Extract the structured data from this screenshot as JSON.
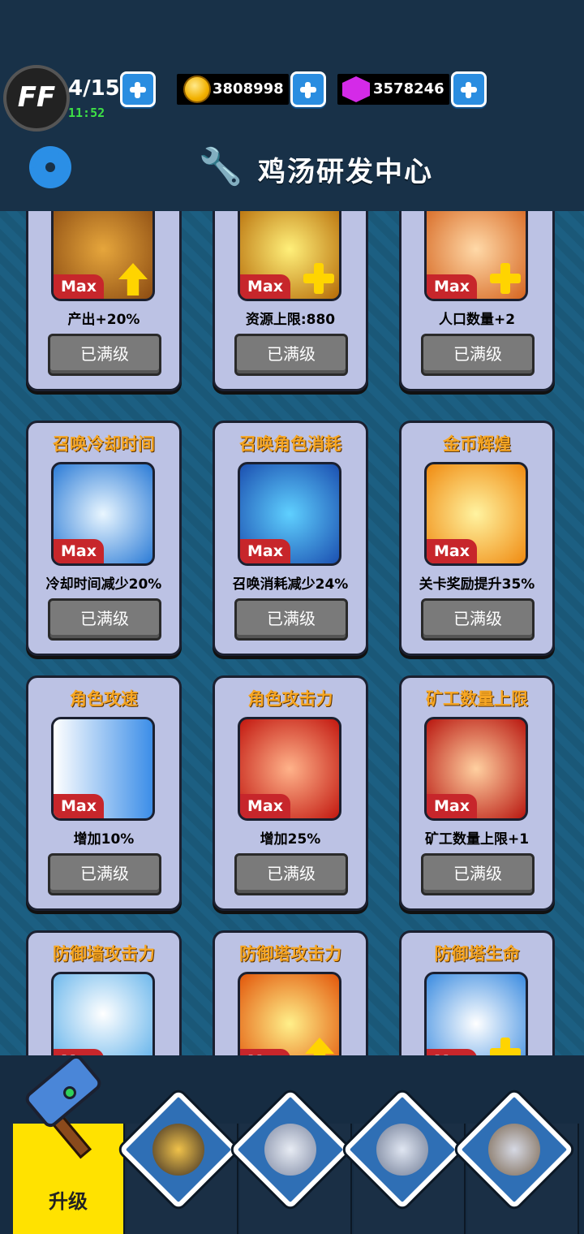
{
  "header": {
    "badge": "FF",
    "energy": "4/15",
    "timer": "11:52",
    "gold": "3808998",
    "gems": "3578246",
    "title": "鸡汤研发中心"
  },
  "cards": [
    {
      "title": "",
      "max": "Max",
      "desc": "产出+20%",
      "button": "已满级",
      "icon": "pickaxe-icon"
    },
    {
      "title": "",
      "max": "Max",
      "desc": "资源上限:880",
      "button": "已满级",
      "icon": "crystal-icon"
    },
    {
      "title": "",
      "max": "Max",
      "desc": "人口数量+2",
      "button": "已满级",
      "icon": "meat-icon"
    },
    {
      "title": "召唤冷却时间",
      "max": "Max",
      "desc": "冷却时间减少20%",
      "button": "已满级",
      "icon": "hourglass-icon"
    },
    {
      "title": "召唤角色消耗",
      "max": "Max",
      "desc": "召唤消耗减少24%",
      "button": "已满级",
      "icon": "discount-card-icon"
    },
    {
      "title": "金币辉煌",
      "max": "Max",
      "desc": "关卡奖励提升35%",
      "button": "已满级",
      "icon": "coins-icon"
    },
    {
      "title": "角色攻速",
      "max": "Max",
      "desc": "增加10%",
      "button": "已满级",
      "icon": "fists-icon"
    },
    {
      "title": "角色攻击力",
      "max": "Max",
      "desc": "增加25%",
      "button": "已满级",
      "icon": "fist-icon"
    },
    {
      "title": "矿工数量上限",
      "max": "Max",
      "desc": "矿工数量上限+1",
      "button": "已满级",
      "icon": "miners-icon"
    },
    {
      "title": "防御墙攻击力",
      "max": "Max",
      "desc": "",
      "button": "",
      "icon": "wall-icon"
    },
    {
      "title": "防御塔攻击力",
      "max": "Max",
      "desc": "",
      "button": "",
      "icon": "rocket-icon"
    },
    {
      "title": "防御塔生命",
      "max": "Max",
      "desc": "",
      "button": "",
      "icon": "tower-icon"
    }
  ],
  "nav": {
    "upgrade_label": "升级",
    "items": [
      "upgrade-hammer-icon",
      "shield-icon",
      "swords-icon",
      "soldiers-icon",
      "chest-icon"
    ]
  },
  "colors": {
    "accent_title": "#f6a623",
    "max_badge": "#c7262b",
    "active_tab": "#ffe200"
  }
}
